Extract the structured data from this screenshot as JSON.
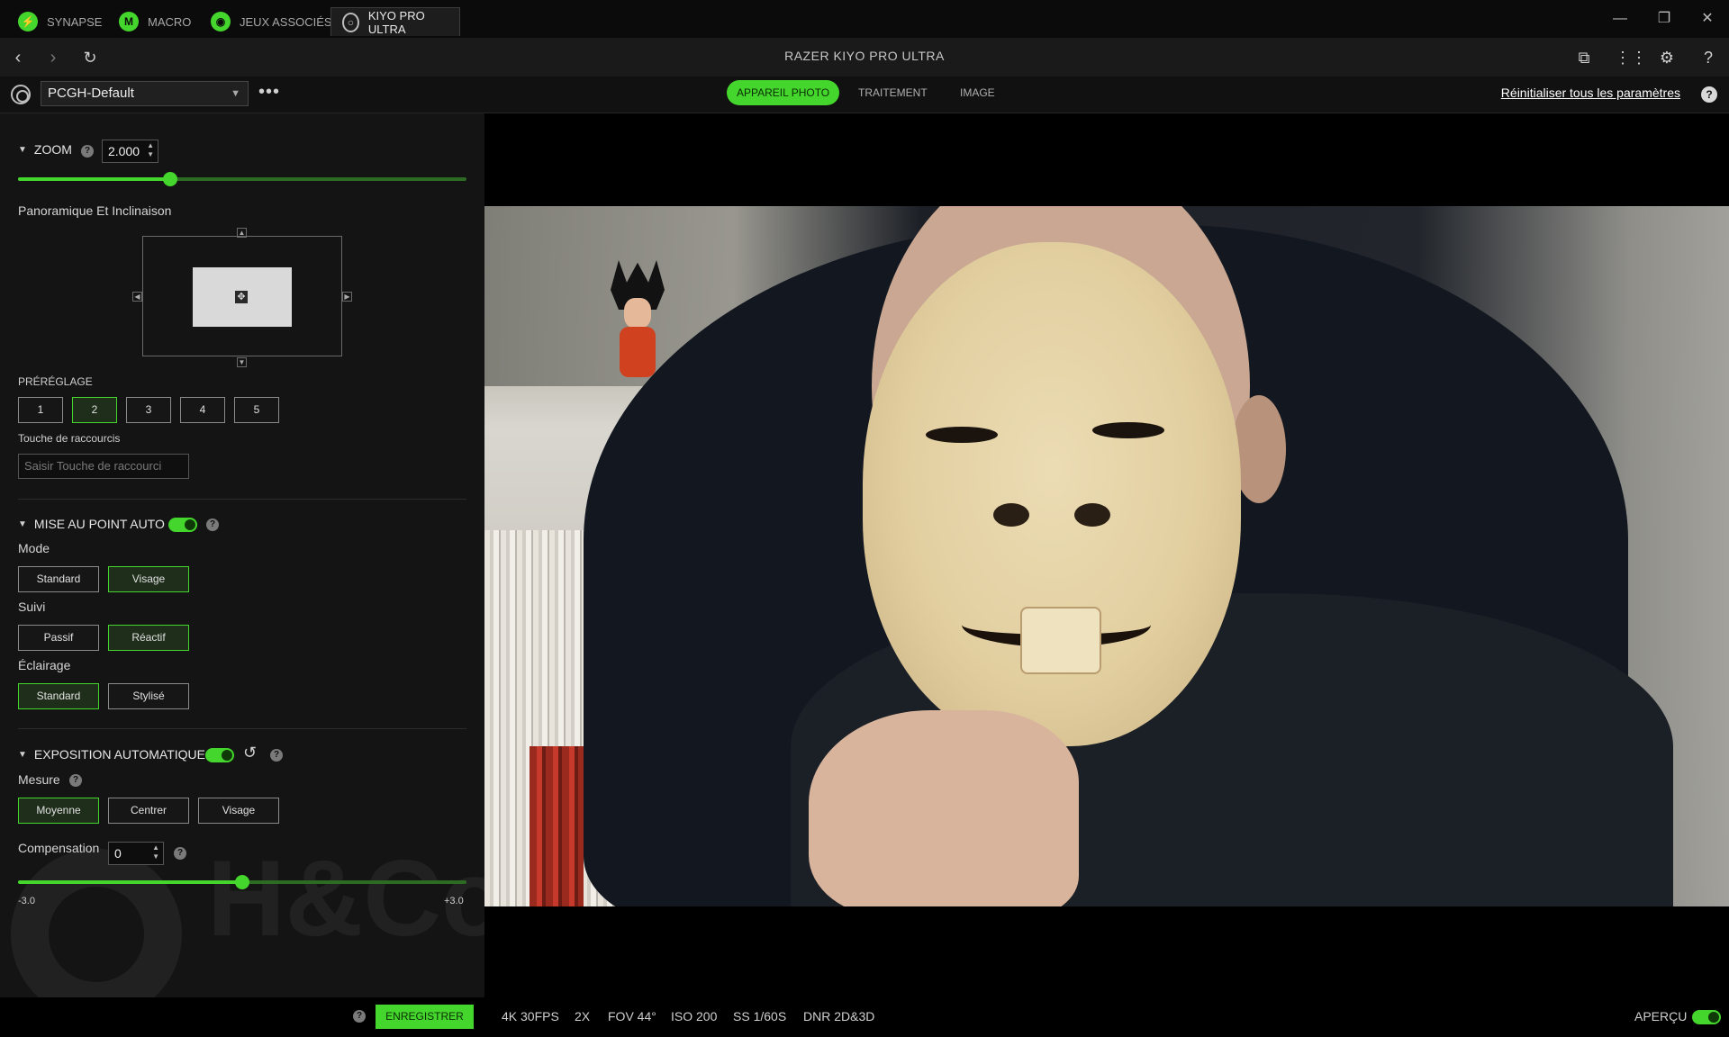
{
  "tabs": [
    {
      "label": "SYNAPSE",
      "icon": "razer-snake-icon"
    },
    {
      "label": "MACRO",
      "icon": "macro-m-icon",
      "glyph": "M"
    },
    {
      "label": "JEUX ASSOCIÉS",
      "icon": "gamepad-icon"
    },
    {
      "label": "KIYO PRO ULTRA",
      "icon": "webcam-icon",
      "active": true
    }
  ],
  "window_controls": {
    "minimize": "—",
    "restore": "❐",
    "close": "✕"
  },
  "nav": {
    "title": "RAZER KIYO PRO ULTRA",
    "back": "‹",
    "forward": "›",
    "refresh": "↻"
  },
  "toolbar": {
    "profile_value": "PCGH-Default",
    "more": "•••",
    "subtabs": [
      "APPAREIL PHOTO",
      "TRAITEMENT",
      "IMAGE"
    ],
    "active_subtab": "APPAREIL PHOTO",
    "reset_link": "Réinitialiser tous les paramètres"
  },
  "zoom": {
    "heading": "ZOOM",
    "value": "2.000",
    "slider_fraction": 0.34
  },
  "pan_tilt": {
    "label": "Panoramique Et Inclinaison"
  },
  "preset": {
    "label": "PRÉRÉGLAGE",
    "buttons": [
      "1",
      "2",
      "3",
      "4",
      "5"
    ],
    "selected": "2",
    "hotkey_label": "Touche de raccourcis",
    "hotkey_placeholder": "Saisir Touche de raccourci"
  },
  "autofocus": {
    "heading": "MISE AU POINT AUTO",
    "enabled": true,
    "mode_label": "Mode",
    "mode_options": [
      "Standard",
      "Visage"
    ],
    "mode_selected": "Visage",
    "tracking_label": "Suivi",
    "tracking_options": [
      "Passif",
      "Réactif"
    ],
    "tracking_selected": "Réactif",
    "lighting_label": "Éclairage",
    "lighting_options": [
      "Standard",
      "Stylisé"
    ],
    "lighting_selected": "Standard"
  },
  "exposure": {
    "heading": "EXPOSITION AUTOMATIQUE",
    "enabled": true,
    "metering_label": "Mesure",
    "metering_options": [
      "Moyenne",
      "Centrer",
      "Visage"
    ],
    "metering_selected": "Moyenne",
    "compensation_label": "Compensation",
    "compensation_value": "0",
    "min_label": "-3.0",
    "max_label": "+3.0",
    "slider_fraction": 0.5
  },
  "bottom": {
    "save_label": "ENREGISTRER",
    "stats": [
      "4K 30FPS",
      "2X",
      "FOV 44°",
      "ISO 200",
      "SS 1/60S",
      "DNR 2D&3D"
    ],
    "preview_label": "APERÇU",
    "preview_enabled": true
  },
  "watermark": {
    "text": "H&Co"
  },
  "colors": {
    "accent": "#44d62c",
    "bg": "#141414",
    "bar": "#0b0b0b"
  }
}
